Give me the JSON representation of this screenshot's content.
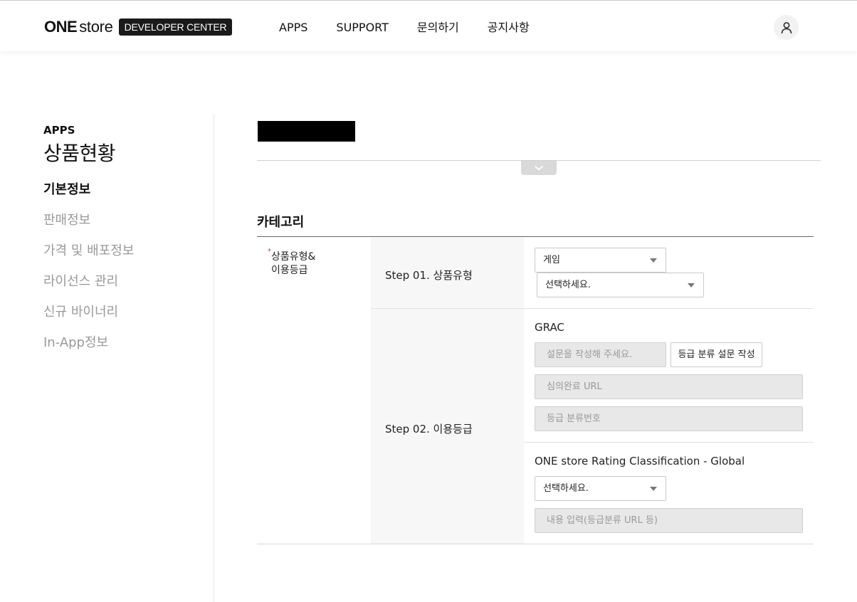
{
  "header": {
    "logo_one": "ONE",
    "logo_store": "store",
    "logo_badge": "DEVELOPER CENTER",
    "nav": [
      "APPS",
      "SUPPORT",
      "문의하기",
      "공지사항"
    ]
  },
  "sidebar": {
    "section": "APPS",
    "title": "상품현황",
    "items": [
      "기본정보",
      "판매정보",
      "가격 및 배포정보",
      "라이선스 관리",
      "신규 바이너리",
      "In-App정보"
    ]
  },
  "category": {
    "title": "카테고리",
    "row_label_line1": "상품유형&",
    "row_label_line2": "이용등급",
    "required_mark": "*",
    "step1": {
      "label": "Step 01. 상품유형",
      "type_select": "게임",
      "genre_select": "선택하세요."
    },
    "step2": {
      "label": "Step 02. 이용등급",
      "grac_title": "GRAC",
      "survey_placeholder": "설문을 작성해 주세요.",
      "survey_button": "등급 분류 설문 작성",
      "url_placeholder": "심의완료 URL",
      "number_placeholder": "등급 분류번호",
      "global_title": "ONE store Rating Classification - Global",
      "global_select": "선택하세요.",
      "content_placeholder": "내용 입력(등급분류 URL 등)"
    }
  },
  "icons": {
    "avatar": "user-icon",
    "collapse": "chevron-down-icon",
    "dropdown": "caret-down-icon"
  }
}
